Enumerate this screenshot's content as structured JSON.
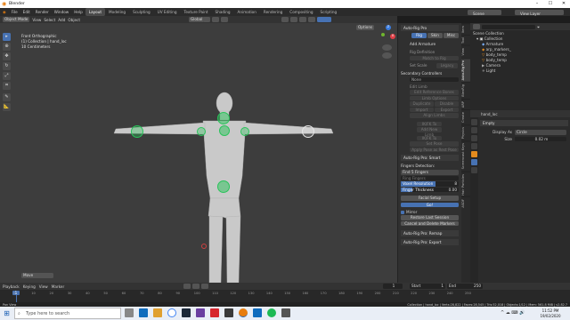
{
  "window": {
    "title": "Blender"
  },
  "menu": {
    "items": [
      "File",
      "Edit",
      "Render",
      "Window",
      "Help"
    ],
    "workspaces": [
      "Layout",
      "Modeling",
      "Sculpting",
      "UV Editing",
      "Texture Paint",
      "Shading",
      "Animation",
      "Rendering",
      "Compositing",
      "Scripting"
    ],
    "scene_label": "Scene",
    "view_layer_label": "View Layer"
  },
  "viewport": {
    "mode": "Object Mode",
    "menus": [
      "View",
      "Select",
      "Add",
      "Object"
    ],
    "orientation": "Global",
    "options": "Options",
    "view_name": "Front Orthographic",
    "collection_line": "(1) Collection | hand_loc",
    "units_line": "10 Centimeters",
    "operator": "Move"
  },
  "npanel": {
    "header": "Auto-Rig Pro",
    "tabs": [
      "Rig",
      "Skin",
      "Misc"
    ],
    "add_armature": "Add Armature",
    "rig_definition": "Rig Definition",
    "match_to_rig": "Match to Rig",
    "set_scale": "Set Scale",
    "legacy": "Legacy",
    "secondary_controllers": "Secondary Controllers",
    "none": "None",
    "edit_limb": "Edit Limb",
    "edit_reference_bones": "Edit Reference Bones",
    "limb_options": "Limb Options",
    "duplicate": "Duplicate",
    "disable": "Disable",
    "import": "Import",
    "export": "Export",
    "align_limbs": "Align Limbs",
    "ik_fk_to": "IK/FK To",
    "add_new_limb": "Add New Limb",
    "ik_fk_to2": "IK/FK To",
    "set_pose": "Set Pose",
    "apply_pose": "Apply Pose as Rest Pose",
    "smart": "Auto-Rig Pro: Smart",
    "fingers_detection": "Fingers Detection:",
    "fingers_select": "Find 5 Fingers",
    "fingers_field": "Ring Fingers",
    "finger_thickness": "Finger Thickness",
    "finger_thickness_val": "0.00",
    "voxel_resolution": "Voxel Resolution",
    "voxel_val": "8",
    "facial_setup": "Facial Setup",
    "go_button": "Go!",
    "mirror": "Mirror",
    "restore_last_session": "Restore Last Session",
    "cancel_delete": "Cancel and Delete Markers",
    "remap": "Auto-Rig Pro: Remap",
    "export_panel": "Auto-Rig Pro: Export"
  },
  "sidetabs": [
    "Item",
    "Tool",
    "View",
    "Auto-Rig Pro",
    "BlenRig",
    "ARP",
    "Create",
    "Physics",
    "Screencast Keys",
    "Hair Particles",
    "ASDF",
    "Rigify",
    "Misc",
    "Scripting Tools",
    "Shortcut VUr",
    "Animation",
    "Edit",
    "Tissue",
    "Rigging Nodes",
    "Export",
    "BoneWidget",
    "Fluid"
  ],
  "outliner": {
    "scene_collection": "Scene Collection",
    "items": [
      {
        "label": "Collection",
        "indent": 0
      },
      {
        "label": "Armature",
        "indent": 1
      },
      {
        "label": "arp_markers_",
        "indent": 1
      },
      {
        "label": "body_temp",
        "indent": 1
      },
      {
        "label": "body_temp",
        "indent": 1
      },
      {
        "label": "Camera",
        "indent": 1
      },
      {
        "label": "Light",
        "indent": 1
      }
    ]
  },
  "properties": {
    "object_name": "hand_loc",
    "section": "Empty",
    "display_as_label": "Display As",
    "display_as_value": "Circle",
    "size_label": "Size",
    "size_value": "0.02 m"
  },
  "timeline": {
    "menus": [
      "Playback",
      "Keying",
      "View",
      "Marker"
    ],
    "current_frame": "1",
    "start_label": "Start",
    "start": "1",
    "end_label": "End",
    "end": "250",
    "ticks": [
      "0",
      "10",
      "20",
      "30",
      "40",
      "50",
      "60",
      "70",
      "80",
      "90",
      "100",
      "110",
      "120",
      "130",
      "140",
      "150",
      "160",
      "170",
      "180",
      "190",
      "200",
      "210",
      "220",
      "230",
      "240",
      "250"
    ]
  },
  "status": {
    "left": "Pan View",
    "right": "Collection | hand_loc | Verts:28,822 | Faces:28,545 | Tris:52,018 | Objects:1/12 | Mem: 561.8 MiB | v2.82.7"
  },
  "taskbar": {
    "search_placeholder": "Type here to search",
    "time": "11:52 PM",
    "date": "19/02/2020"
  },
  "colors": {
    "accent": "#4772b3",
    "marker": "#29c45a",
    "selected": "#e38b1e"
  }
}
